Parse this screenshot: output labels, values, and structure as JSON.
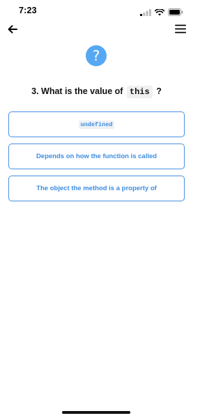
{
  "status_bar": {
    "time": "7:23",
    "icons": [
      "signal-icon",
      "wifi-icon",
      "battery-icon"
    ]
  },
  "nav": {
    "back_icon": "arrow-left-icon",
    "menu_icon": "hamburger-menu-icon"
  },
  "question": {
    "badge_symbol": "?",
    "prefix": "3. What is the value of",
    "code": "this",
    "suffix": "?"
  },
  "answers": [
    {
      "label": "undefined",
      "is_code": true
    },
    {
      "label": "Depends on how the function is called",
      "is_code": false
    },
    {
      "label": "The object the method is a property of",
      "is_code": false
    }
  ],
  "colors": {
    "accent": "#4a90e2",
    "badge": "#56a8f3",
    "answer_text": "#3d8de0"
  }
}
